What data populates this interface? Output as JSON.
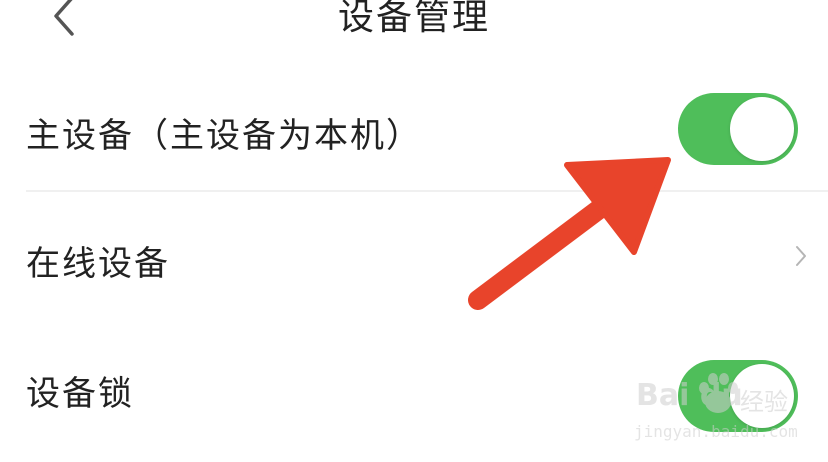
{
  "nav": {
    "title": "设备管理",
    "back_icon": "chevron-left-icon"
  },
  "settings": [
    {
      "label": "主设备（主设备为本机）",
      "control": "toggle",
      "enabled": true
    },
    {
      "label": "在线设备",
      "control": "chevron",
      "icon": "chevron-right-icon"
    },
    {
      "label": "设备锁",
      "control": "toggle",
      "enabled": true
    }
  ],
  "colors": {
    "toggle_on": "#4fbe5a",
    "annotation_arrow": "#e8442b",
    "text": "#222222"
  },
  "watermark": {
    "logo": "Bai du",
    "brand": "经验",
    "url": "jingyan.baidu.com"
  }
}
